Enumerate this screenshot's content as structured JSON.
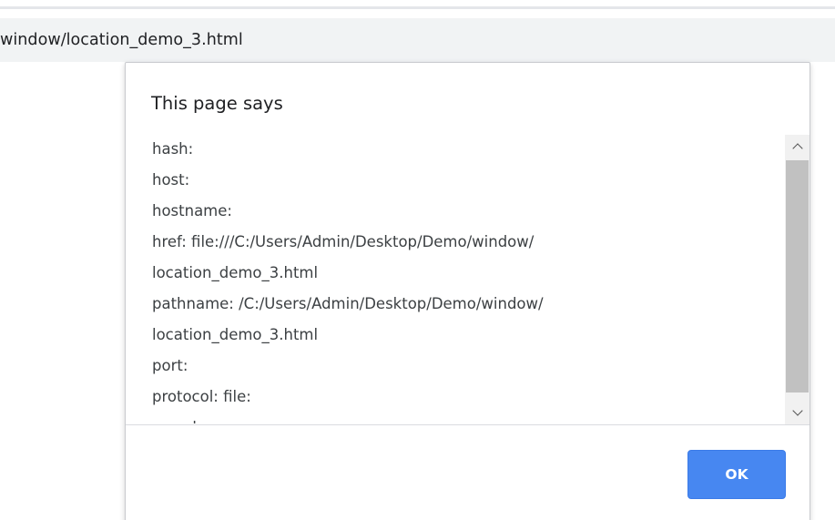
{
  "browser": {
    "address_text": "window/location_demo_3.html"
  },
  "dialog": {
    "title": "This page says",
    "message_lines": [
      "hash:",
      "host:",
      "hostname:",
      "href: file:///C:/Users/Admin/Desktop/Demo/window/",
      "location_demo_3.html",
      "pathname: /C:/Users/Admin/Desktop/Demo/window/",
      "location_demo_3.html",
      "port:",
      "protocol: file:",
      "search:"
    ],
    "ok_label": "OK",
    "scroll_up_icon": "chevron-up-icon",
    "scroll_down_icon": "chevron-down-icon"
  },
  "colors": {
    "ok_button": "#4787f1",
    "address_bar": "#f1f3f4",
    "scroll_thumb": "#c1c1c1"
  }
}
